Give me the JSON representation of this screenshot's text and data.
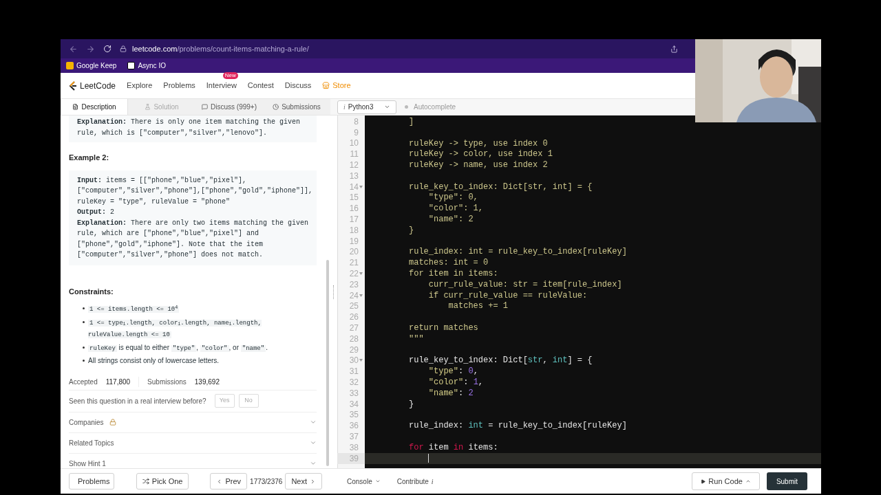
{
  "browser": {
    "url_domain": "leetcode.com",
    "url_path": "/problems/count-items-matching-a-rule/",
    "bookmarks": [
      "Google Keep",
      "Async IO"
    ]
  },
  "site_nav": {
    "logo": "LeetCode",
    "items": [
      {
        "label": "Explore",
        "kind": "link"
      },
      {
        "label": "Problems",
        "kind": "link"
      },
      {
        "label": "Interview",
        "badge": "New",
        "kind": "link"
      },
      {
        "label": "Contest",
        "kind": "link"
      },
      {
        "label": "Discuss",
        "kind": "link"
      },
      {
        "label": "Store",
        "kind": "store"
      }
    ]
  },
  "tabs": [
    {
      "label": "Description",
      "selected": true,
      "disabled": false
    },
    {
      "label": "Solution",
      "selected": false,
      "disabled": true
    },
    {
      "label": "Discuss (999+)",
      "selected": false,
      "disabled": false
    },
    {
      "label": "Submissions",
      "selected": false,
      "disabled": false
    }
  ],
  "language": {
    "icon": "i",
    "value": "Python3"
  },
  "autocomplete": {
    "label": "Autocomplete",
    "on": false
  },
  "description": {
    "explanation_1": [
      "**Explanation:** There is only one item matching the given",
      "rule, which is [\"computer\",\"silver\",\"lenovo\"]."
    ],
    "example_2_title": "Example 2:",
    "example_2": [
      "**Input:** items = [[\"phone\",\"blue\",\"pixel\"],",
      "[\"computer\",\"silver\",\"phone\"],[\"phone\",\"gold\",\"iphone\"]],",
      "ruleKey = \"type\", ruleValue = \"phone\"",
      "**Output:** 2",
      "**Explanation:** There are only two items matching the given",
      "rule, which are [\"phone\",\"blue\",\"pixel\"] and",
      "[\"phone\",\"gold\",\"iphone\"]. Note that the item",
      "[\"computer\",\"silver\",\"phone\"] does not match."
    ],
    "constraints_title": "Constraints:",
    "constraints": [
      [
        {
          "kind": "code",
          "text": "1 <= items.length <= 10$^{4}$"
        }
      ],
      [
        {
          "kind": "code",
          "text": "1 <= type$_{i}$.length, color$_{i}$.length, name$_{i}$.length, ruleValue.length <= 10"
        }
      ],
      [
        {
          "kind": "code",
          "text": "ruleKey"
        },
        {
          "kind": "text",
          "text": " is equal to either "
        },
        {
          "kind": "code",
          "text": "\"type\""
        },
        {
          "kind": "text",
          "text": ", "
        },
        {
          "kind": "code",
          "text": "\"color\""
        },
        {
          "kind": "text",
          "text": ", or "
        },
        {
          "kind": "code",
          "text": "\"name\""
        },
        {
          "kind": "text",
          "text": "."
        }
      ],
      [
        {
          "kind": "text",
          "text": "All strings consist only of lowercase letters."
        }
      ]
    ],
    "stats": [
      {
        "label": "Accepted",
        "value": "117,800"
      },
      {
        "label": "Submissions",
        "value": "139,692"
      }
    ],
    "interview_question": "Seen this question in a real interview before?",
    "answers": [
      "Yes",
      "No"
    ],
    "sections": [
      {
        "label": "Companies",
        "locked": true,
        "expanded": false
      },
      {
        "label": "Related Topics",
        "locked": false,
        "expanded": false
      },
      {
        "label": "Show Hint 1",
        "locked": false,
        "expanded": false
      }
    ]
  },
  "code_lines": [
    {
      "number": "8",
      "foldable": false,
      "active": false,
      "tokens": [
        {
          "kind": "doc",
          "text": "]"
        }
      ]
    },
    {
      "number": "9",
      "foldable": false,
      "active": false
    },
    {
      "number": "10",
      "foldable": false,
      "active": false,
      "tokens": [
        {
          "kind": "doc",
          "text": "ruleKey -> type, use index 0"
        }
      ]
    },
    {
      "number": "11",
      "foldable": false,
      "active": false,
      "tokens": [
        {
          "kind": "doc",
          "text": "ruleKey -> color, use index 1"
        }
      ]
    },
    {
      "number": "12",
      "foldable": false,
      "active": false,
      "tokens": [
        {
          "kind": "doc",
          "text": "ruleKey -> name, use index 2"
        }
      ]
    },
    {
      "number": "13",
      "foldable": false,
      "active": false
    },
    {
      "number": "14",
      "foldable": true,
      "active": false,
      "tokens": [
        {
          "kind": "doc",
          "text": "rule_key_to_index: Dict[str, int] = {"
        }
      ]
    },
    {
      "number": "15",
      "foldable": false,
      "active": false,
      "tokens": [
        {
          "kind": "doc",
          "text": "    \"type\": 0,"
        }
      ]
    },
    {
      "number": "16",
      "foldable": false,
      "active": false,
      "tokens": [
        {
          "kind": "doc",
          "text": "    \"color\": 1,"
        }
      ]
    },
    {
      "number": "17",
      "foldable": false,
      "active": false,
      "tokens": [
        {
          "kind": "doc",
          "text": "    \"name\": 2"
        }
      ]
    },
    {
      "number": "18",
      "foldable": false,
      "active": false,
      "tokens": [
        {
          "kind": "doc",
          "text": "}"
        }
      ]
    },
    {
      "number": "19",
      "foldable": false,
      "active": false
    },
    {
      "number": "20",
      "foldable": false,
      "active": false,
      "tokens": [
        {
          "kind": "doc",
          "text": "rule_index: int = rule_key_to_index[ruleKey]"
        }
      ]
    },
    {
      "number": "21",
      "foldable": false,
      "active": false,
      "tokens": [
        {
          "kind": "doc",
          "text": "matches: int = 0"
        }
      ]
    },
    {
      "number": "22",
      "foldable": true,
      "active": false,
      "tokens": [
        {
          "kind": "doc",
          "text": "for item in items:"
        }
      ]
    },
    {
      "number": "23",
      "foldable": false,
      "active": false,
      "tokens": [
        {
          "kind": "doc",
          "text": "    curr_rule_value: str = item[rule_index]"
        }
      ]
    },
    {
      "number": "24",
      "foldable": true,
      "active": false,
      "tokens": [
        {
          "kind": "doc",
          "text": "    if curr_rule_value == ruleValue:"
        }
      ]
    },
    {
      "number": "25",
      "foldable": false,
      "active": false,
      "tokens": [
        {
          "kind": "doc",
          "text": "        matches += 1"
        }
      ]
    },
    {
      "number": "26",
      "foldable": false,
      "active": false
    },
    {
      "number": "27",
      "foldable": false,
      "active": false,
      "tokens": [
        {
          "kind": "doc",
          "text": "return matches"
        }
      ]
    },
    {
      "number": "28",
      "foldable": false,
      "active": false,
      "tokens": [
        {
          "kind": "doc",
          "text": "\"\"\""
        }
      ]
    },
    {
      "number": "29",
      "foldable": false,
      "active": false
    },
    {
      "number": "30",
      "foldable": true,
      "active": false,
      "tokens": [
        {
          "kind": "plain",
          "text": "rule_key_to_index: Dict["
        },
        {
          "kind": "type",
          "text": "str"
        },
        {
          "kind": "plain",
          "text": ", "
        },
        {
          "kind": "type",
          "text": "int"
        },
        {
          "kind": "plain",
          "text": "] = {"
        }
      ]
    },
    {
      "number": "31",
      "foldable": false,
      "active": false,
      "tokens": [
        {
          "kind": "string",
          "text": "    \"type\""
        },
        {
          "kind": "plain",
          "text": ": "
        },
        {
          "kind": "number",
          "text": "0"
        },
        {
          "kind": "plain",
          "text": ","
        }
      ]
    },
    {
      "number": "32",
      "foldable": false,
      "active": false,
      "tokens": [
        {
          "kind": "string",
          "text": "    \"color\""
        },
        {
          "kind": "plain",
          "text": ": "
        },
        {
          "kind": "number",
          "text": "1"
        },
        {
          "kind": "plain",
          "text": ","
        }
      ]
    },
    {
      "number": "33",
      "foldable": false,
      "active": false,
      "tokens": [
        {
          "kind": "string",
          "text": "    \"name\""
        },
        {
          "kind": "plain",
          "text": ": "
        },
        {
          "kind": "number",
          "text": "2"
        }
      ]
    },
    {
      "number": "34",
      "foldable": false,
      "active": false,
      "tokens": [
        {
          "kind": "plain",
          "text": "}"
        }
      ]
    },
    {
      "number": "35",
      "foldable": false,
      "active": false
    },
    {
      "number": "36",
      "foldable": false,
      "active": false,
      "tokens": [
        {
          "kind": "plain",
          "text": "rule_index: "
        },
        {
          "kind": "type",
          "text": "int"
        },
        {
          "kind": "plain",
          "text": " = rule_key_to_index[ruleKey]"
        }
      ]
    },
    {
      "number": "37",
      "foldable": false,
      "active": false
    },
    {
      "number": "38",
      "foldable": false,
      "active": false,
      "tokens": [
        {
          "kind": "keyword",
          "text": "for"
        },
        {
          "kind": "plain",
          "text": " item "
        },
        {
          "kind": "keyword",
          "text": "in"
        },
        {
          "kind": "plain",
          "text": " items:"
        }
      ]
    },
    {
      "number": "39",
      "foldable": false,
      "active": true
    }
  ],
  "footer": {
    "problems": "Problems",
    "pick_one": "Pick One",
    "prev": "Prev",
    "position": "1773/2376",
    "next": "Next",
    "console": "Console",
    "contribute": "Contribute",
    "contribute_icon": "i",
    "run": "Run Code",
    "submit": "Submit"
  }
}
